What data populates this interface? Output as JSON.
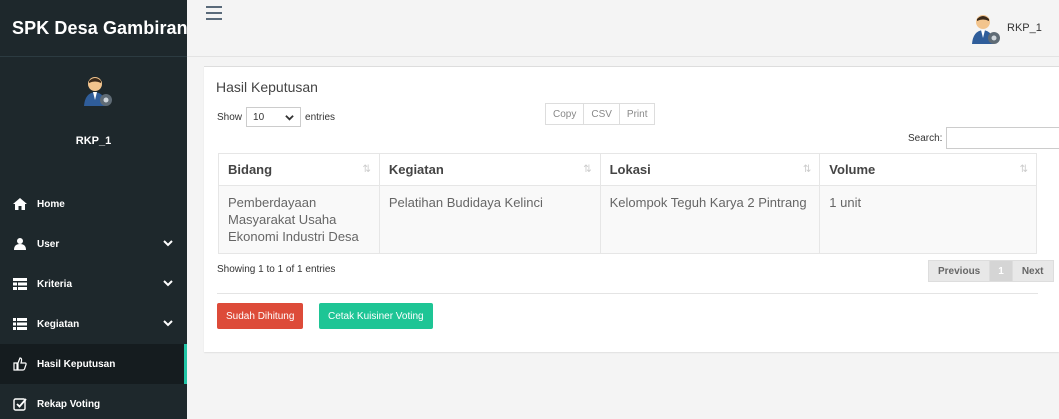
{
  "sidebar": {
    "brand": "SPK Desa Gambiran",
    "username": "RKP_1",
    "items": [
      {
        "label": "Home",
        "icon": "home-icon"
      },
      {
        "label": "User",
        "icon": "user-icon"
      },
      {
        "label": "Kriteria",
        "icon": "table-icon"
      },
      {
        "label": "Kegiatan",
        "icon": "list-icon"
      },
      {
        "label": "Hasil Keputusan",
        "icon": "thumbs-up-icon"
      },
      {
        "label": "Rekap Voting",
        "icon": "check-square-icon"
      }
    ]
  },
  "topbar": {
    "username": "RKP_1"
  },
  "box": {
    "title": "Hasil Keputusan",
    "show_label": "Show",
    "entries_label": "entries",
    "length_value": "10",
    "buttons": {
      "copy": "Copy",
      "csv": "CSV",
      "print": "Print"
    },
    "search_label": "Search:"
  },
  "table": {
    "headers": [
      "Bidang",
      "Kegiatan",
      "Lokasi",
      "Volume"
    ],
    "rows": [
      [
        "Pemberdayaan Masyarakat Usaha Ekonomi Industri Desa",
        "Pelatihan Budidaya Kelinci",
        "Kelompok Teguh Karya 2 Pintrang",
        "1 unit"
      ]
    ]
  },
  "footer": {
    "info": "Showing 1 to 1 of 1 entries",
    "previous": "Previous",
    "page": "1",
    "next": "Next"
  },
  "actions": {
    "sudah": "Sudah Dihitung",
    "cetak": "Cetak Kuisiner Voting"
  },
  "colors": {
    "sidebar_bg": "#1e282c",
    "danger": "#dd4b39",
    "success": "#1ec595"
  }
}
